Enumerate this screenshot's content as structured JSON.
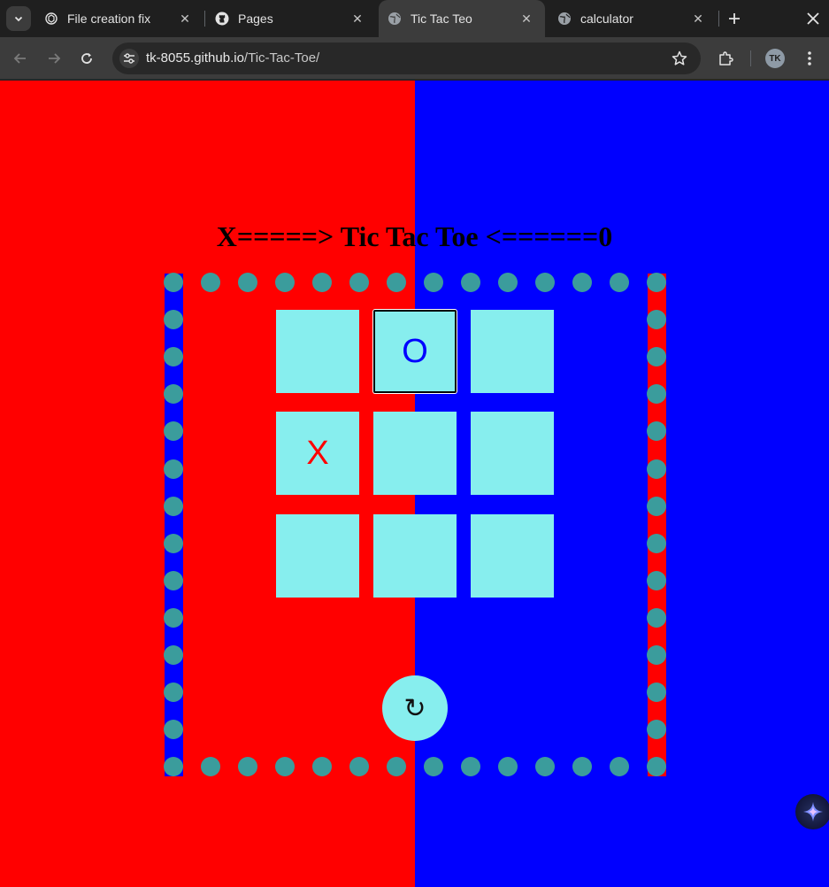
{
  "browser": {
    "tabs": [
      {
        "title": "File creation fix",
        "icon": "chatgpt-icon",
        "active": false
      },
      {
        "title": "Pages",
        "icon": "github-icon",
        "active": false
      },
      {
        "title": "Tic Tac Teo",
        "icon": "globe-icon",
        "active": true
      },
      {
        "title": "calculator",
        "icon": "globe-icon",
        "active": false
      }
    ],
    "url_host": "tk-8055.github.io",
    "url_path": "/Tic-Tac-Toe/",
    "profile_initials": "TK"
  },
  "page": {
    "title": "X=====> Tic Tac Toe <======0",
    "board": [
      [
        "",
        "O",
        ""
      ],
      [
        "X",
        "",
        ""
      ],
      [
        "",
        "",
        ""
      ]
    ],
    "focused_cell": "0-1",
    "reset_label": "↻"
  },
  "colors": {
    "left_bg": "#ff0000",
    "right_bg": "#0000ff",
    "cell": "#87eeee",
    "dot": "#3b9c9c",
    "x_mark": "#ff0000",
    "o_mark": "#0000ff"
  }
}
